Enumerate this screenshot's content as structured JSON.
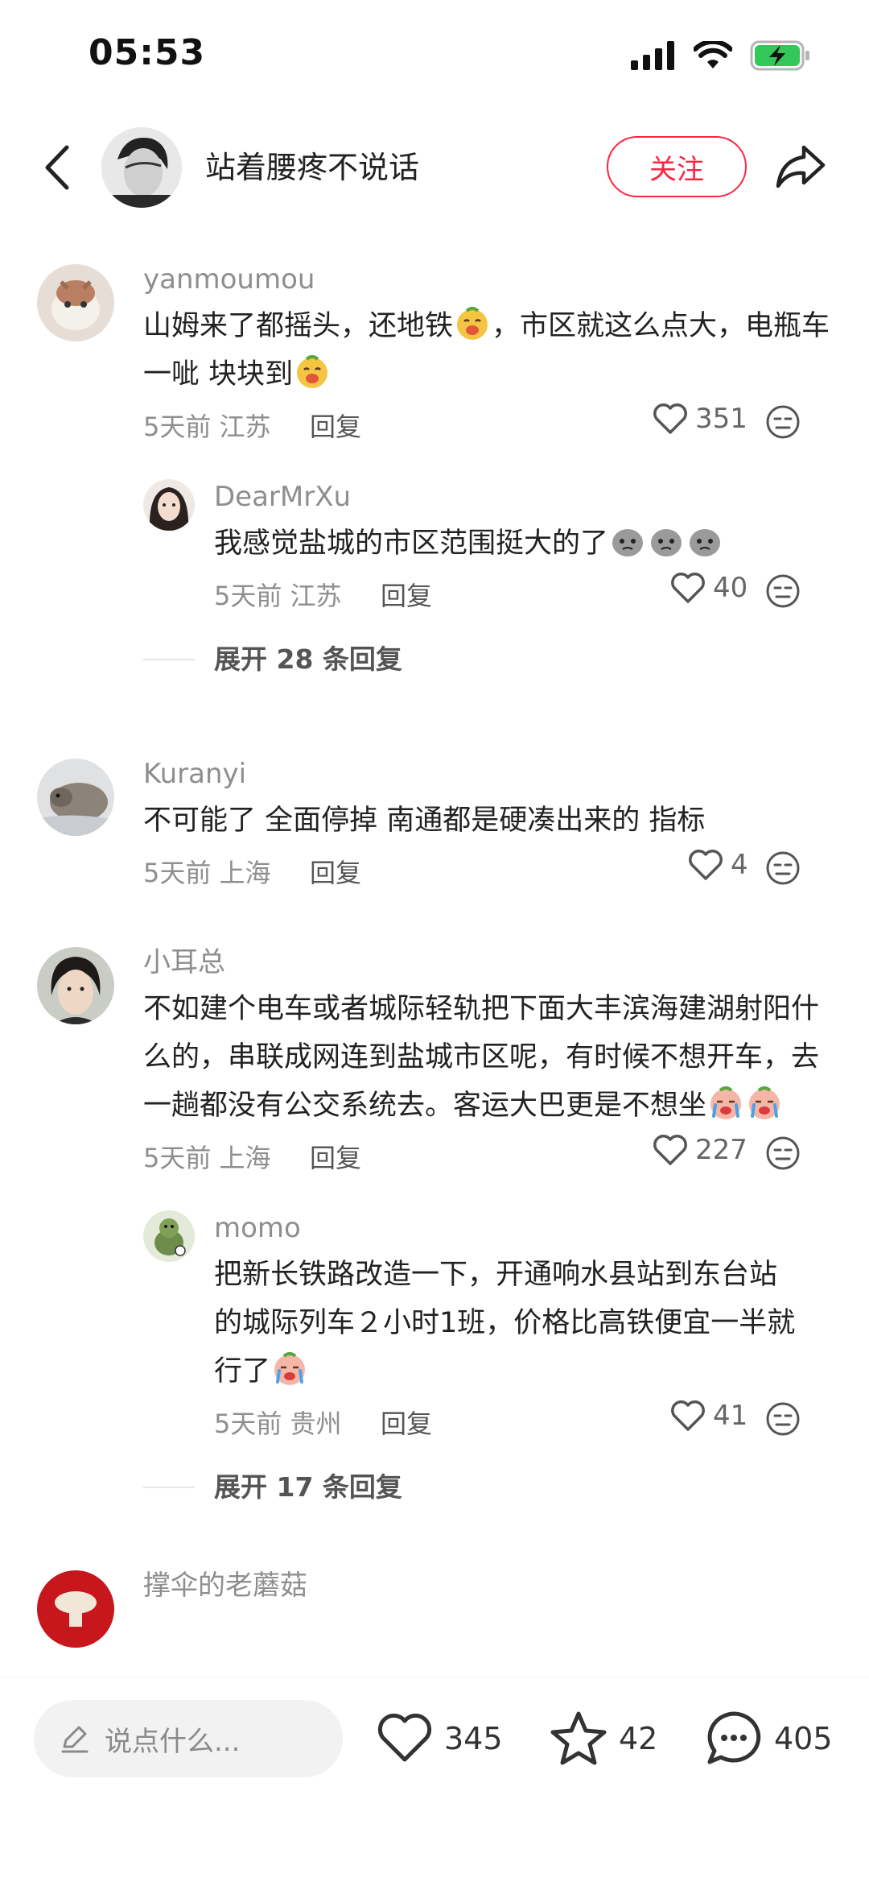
{
  "status_bar": {
    "time": "05:53"
  },
  "header": {
    "author_name": "站着腰疼不说话",
    "follow_label": "关注"
  },
  "comments": [
    {
      "username": "yanmoumou",
      "text_part1": "山姆来了都摇头，还地铁",
      "text_part2": "，市区就这么点大，电瓶车一呲 块块到",
      "time": "5天前",
      "location": "江苏",
      "reply_label": "回复",
      "likes": "351",
      "reply": {
        "username": "DearMrXu",
        "text": "我感觉盐城的市区范围挺大的了",
        "time": "5天前",
        "location": "江苏",
        "reply_label": "回复",
        "likes": "40"
      },
      "expand_label": "展开 28 条回复"
    },
    {
      "username": "Kuranyi",
      "text": "不可能了 全面停掉 南通都是硬凑出来的 指标",
      "time": "5天前",
      "location": "上海",
      "reply_label": "回复",
      "likes": "4"
    },
    {
      "username": "小耳总",
      "text": "不如建个电车或者城际轻轨把下面大丰滨海建湖射阳什么的，串联成网连到盐城市区呢，有时候不想开车，去一趟都没有公交系统去。客运大巴更是不想坐",
      "time": "5天前",
      "location": "上海",
      "reply_label": "回复",
      "likes": "227",
      "reply": {
        "username": "momo",
        "text": "把新长铁路改造一下，开通响水县站到东台站的城际列车２小时1班，价格比高铁便宜一半就行了",
        "time": "5天前",
        "location": "贵州",
        "reply_label": "回复",
        "likes": "41"
      },
      "expand_label": "展开 17 条回复"
    },
    {
      "username": "撑伞的老蘑菇"
    }
  ],
  "bottom_bar": {
    "input_placeholder": "说点什么...",
    "likes": "345",
    "favorites": "42",
    "comments": "405"
  },
  "colors": {
    "accent": "#ff2442",
    "battery": "#34c759"
  }
}
